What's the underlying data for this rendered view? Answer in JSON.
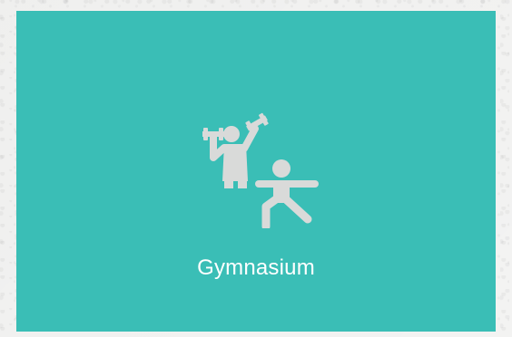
{
  "tile": {
    "label": "Gymnasium",
    "icon": "fitness-exercise-icon",
    "background_color": "#3abeb6",
    "icon_color": "#d9dad9",
    "text_color": "#ffffff"
  }
}
